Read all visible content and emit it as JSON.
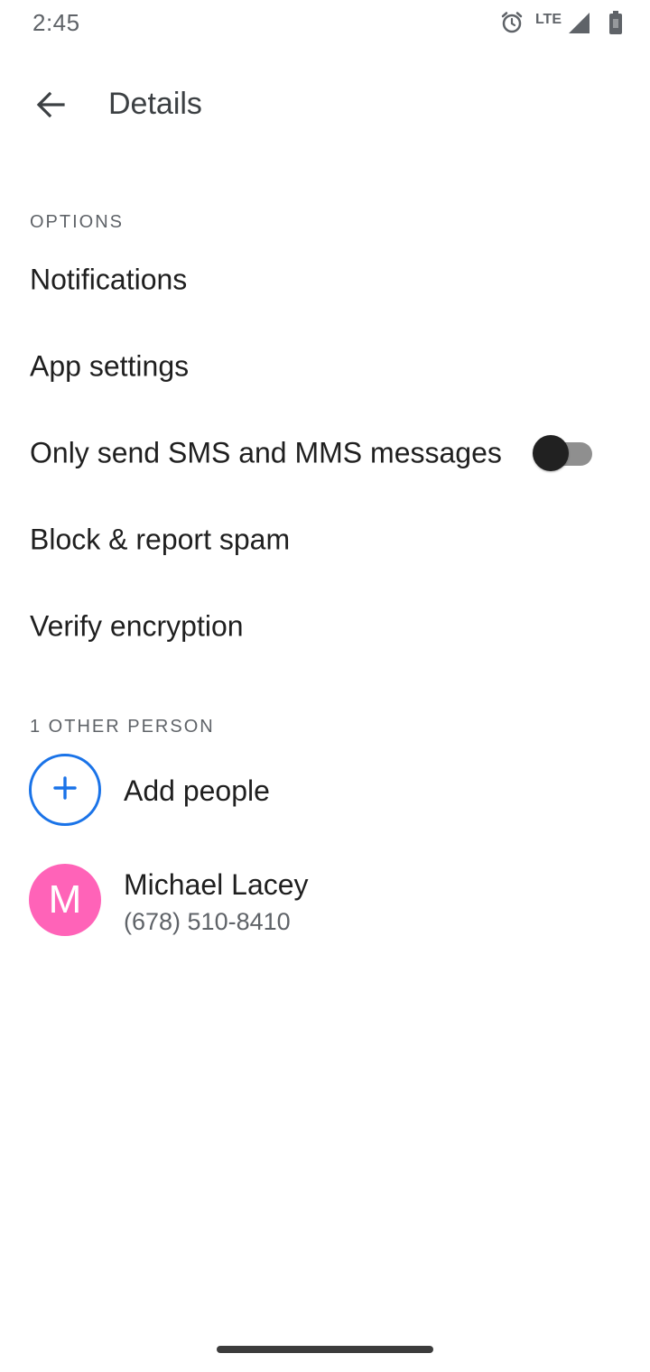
{
  "status_bar": {
    "time": "2:45",
    "network": "LTE",
    "icons": [
      "alarm-icon",
      "signal-icon",
      "battery-icon"
    ]
  },
  "header": {
    "title": "Details",
    "back_icon": "arrow-back-icon"
  },
  "options_section": {
    "title": "OPTIONS",
    "items": [
      {
        "label": "Notifications"
      },
      {
        "label": "App settings"
      },
      {
        "label": "Only send SMS and MMS messages",
        "toggle": false
      },
      {
        "label": "Block & report spam"
      },
      {
        "label": "Verify encryption"
      }
    ]
  },
  "people_section": {
    "title": "1 OTHER PERSON",
    "add_label": "Add people",
    "add_icon": "plus-icon",
    "contacts": [
      {
        "initial": "M",
        "name": "Michael Lacey",
        "phone": "(678) 510-8410",
        "avatar_color": "#ff63b8"
      }
    ]
  },
  "colors": {
    "accent": "#1a73e8",
    "text_primary": "#1f1f1f",
    "text_secondary": "#5f6368"
  }
}
